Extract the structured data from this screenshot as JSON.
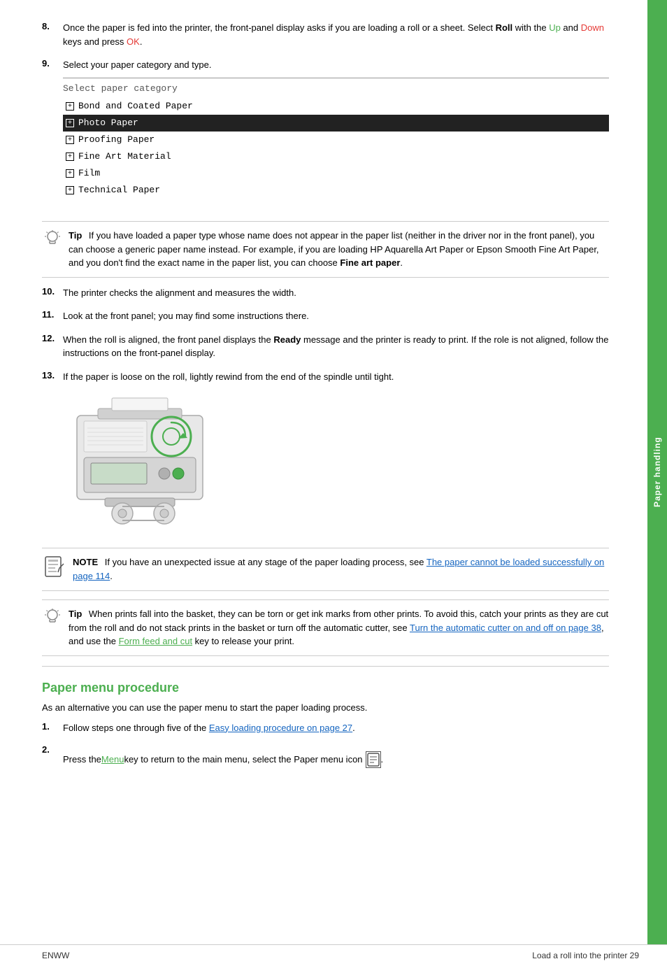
{
  "page": {
    "footer_left": "ENWW",
    "footer_right": "Load a roll into the printer   29",
    "side_tab": "Paper handling"
  },
  "step8": {
    "number": "8.",
    "text_before_roll": "Once the paper is fed into the printer, the front-panel display asks if you are loading a roll or a sheet. Select ",
    "bold_roll": "Roll",
    "text_with_keys": " with the ",
    "key_up": "Up",
    "text_and": " and ",
    "key_down": "Down",
    "text_keys_ok": " keys and press ",
    "key_ok": "OK",
    "text_end": "."
  },
  "step9": {
    "number": "9.",
    "text": "Select your paper category and type."
  },
  "paper_menu": {
    "title": "Select paper category",
    "items": [
      {
        "label": "Bond and Coated Paper",
        "selected": false
      },
      {
        "label": "Photo Paper",
        "selected": true
      },
      {
        "label": "Proofing Paper",
        "selected": false
      },
      {
        "label": "Fine Art Material",
        "selected": false
      },
      {
        "label": "Film",
        "selected": false
      },
      {
        "label": "Technical Paper",
        "selected": false
      }
    ]
  },
  "tip1": {
    "label": "Tip",
    "text_before": "If you have loaded a paper type whose name does not appear in the paper list (neither in the driver nor in the front panel), you can choose a generic paper name instead. For example, if you are loading HP Aquarella Art Paper or Epson Smooth Fine Art Paper, and you don't find the exact name in the paper list, you can choose ",
    "bold_text": "Fine art paper",
    "text_end": "."
  },
  "step10": {
    "number": "10.",
    "text": "The printer checks the alignment and measures the width."
  },
  "step11": {
    "number": "11.",
    "text": "Look at the front panel; you may find some instructions there."
  },
  "step12": {
    "number": "12.",
    "text_before": "When the roll is aligned, the front panel displays the ",
    "bold_ready": "Ready",
    "text_after": " message and the printer is ready to print. If the role is not aligned, follow the instructions on the front-panel display."
  },
  "step13": {
    "number": "13.",
    "text": "If the paper is loose on the roll, lightly rewind from the end of the spindle until tight."
  },
  "note1": {
    "label": "NOTE",
    "text_before": "If you have an unexpected issue at any stage of the paper loading process, see ",
    "link_text": "The paper cannot be loaded successfully on page 114",
    "text_end": "."
  },
  "tip2": {
    "label": "Tip",
    "text_before": "When prints fall into the basket, they can be torn or get ink marks from other prints. To avoid this, catch your prints as they are cut from the roll and do not stack prints in the basket or turn off the automatic cutter, see ",
    "link1_text": "Turn the automatic cutter on and off on page 38",
    "text_middle": ", and use the ",
    "link2_text": "Form feed and cut",
    "text_end": " key to release your print."
  },
  "section_heading": "Paper menu procedure",
  "section_intro": "As an alternative you can use the paper menu to start the paper loading process.",
  "section_step1": {
    "number": "1.",
    "text_before": "Follow steps one through five of the ",
    "link_text": "Easy loading procedure on page 27",
    "text_end": "."
  },
  "section_step2": {
    "number": "2.",
    "text_before": "Press the ",
    "link_menu": "Menu",
    "text_after": " key to return to the main menu, select the Paper menu icon"
  }
}
